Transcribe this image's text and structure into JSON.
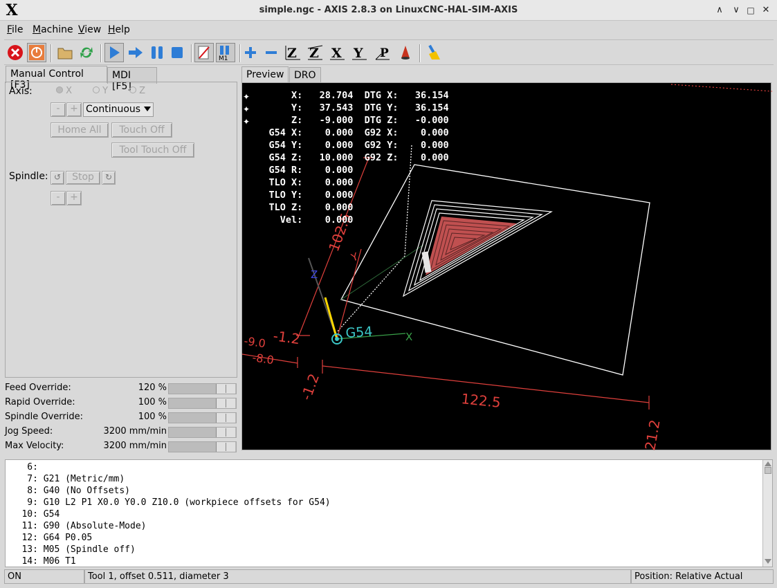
{
  "window": {
    "title": "simple.ngc - AXIS 2.8.3 on LinuxCNC-HAL-SIM-AXIS",
    "controls": {
      "collapse": "^",
      "minimize": "□",
      "close": "✕"
    }
  },
  "menu": [
    "File",
    "Machine",
    "View",
    "Help"
  ],
  "toolbar": {
    "icons": [
      "estop-icon",
      "machine-power-icon",
      "open-file-icon",
      "reload-icon",
      "run-icon",
      "step-icon",
      "pause-icon",
      "stop-icon",
      "block-delete-icon",
      "optional-stop-icon",
      "zoom-in-icon",
      "zoom-out-icon",
      "view-z-icon",
      "view-z2-icon",
      "view-x-icon",
      "view-y-icon",
      "view-p-icon",
      "rotate-view-icon",
      "clear-plot-icon"
    ],
    "optional_stop_label": "M1"
  },
  "left_tabs": [
    "Manual Control [F3]",
    "MDI [F5]"
  ],
  "manual": {
    "axis_label": "Axis:",
    "axes": [
      "X",
      "Y",
      "Z"
    ],
    "minus": "-",
    "plus": "+",
    "jog_mode": "Continuous",
    "home_all": "Home All",
    "touch_off": "Touch Off",
    "tool_touch_off": "Tool Touch Off",
    "spindle_label": "Spindle:",
    "spindle_stop": "Stop"
  },
  "overrides": [
    {
      "label": "Feed Override:",
      "value": "120 %",
      "level": 0.7
    },
    {
      "label": "Rapid Override:",
      "value": "100 %",
      "level": 0.7
    },
    {
      "label": "Spindle Override:",
      "value": "100 %",
      "level": 0.7
    },
    {
      "label": "Jog Speed:",
      "value": "3200 mm/min",
      "level": 0.7
    },
    {
      "label": "Max Velocity:",
      "value": "3200 mm/min",
      "level": 0.7
    }
  ],
  "preview_tabs": [
    "Preview",
    "DRO"
  ],
  "dro": [
    {
      "label": "X:",
      "value": "28.704",
      "label2": "DTG X:",
      "value2": "36.154"
    },
    {
      "label": "Y:",
      "value": "37.543",
      "label2": "DTG Y:",
      "value2": "36.154"
    },
    {
      "label": "Z:",
      "value": "-9.000",
      "label2": "DTG Z:",
      "value2": "-0.000"
    },
    {
      "label": "G54 X:",
      "value": "0.000",
      "label2": "G92 X:",
      "value2": "0.000"
    },
    {
      "label": "G54 Y:",
      "value": "0.000",
      "label2": "G92 Y:",
      "value2": "0.000"
    },
    {
      "label": "G54 Z:",
      "value": "10.000",
      "label2": "G92 Z:",
      "value2": "0.000"
    },
    {
      "label": "G54 R:",
      "value": "0.000",
      "label2": "",
      "value2": ""
    },
    {
      "label": "TLO X:",
      "value": "0.000",
      "label2": "",
      "value2": ""
    },
    {
      "label": "TLO Y:",
      "value": "0.000",
      "label2": "",
      "value2": ""
    },
    {
      "label": "TLO Z:",
      "value": "0.000",
      "label2": "",
      "value2": ""
    },
    {
      "label": "Vel:",
      "value": "0.000",
      "label2": "",
      "value2": ""
    }
  ],
  "preview_labels": {
    "dim_width": "122.5",
    "dim_left": "-1.2",
    "dim_height": "102.5",
    "dim_right": "21.2",
    "dim_z": "-1.2",
    "dim_z2": "-9.0",
    "dim_z3": "-8.0",
    "offset_label": "G54",
    "axis_x": "X",
    "axis_y": "Y",
    "axis_z": "Z"
  },
  "code_lines": [
    {
      "n": "6:",
      "text": ""
    },
    {
      "n": "7:",
      "text": "G21 (Metric/mm)"
    },
    {
      "n": "8:",
      "text": "G40 (No Offsets)"
    },
    {
      "n": "9:",
      "text": "G10 L2 P1 X0.0 Y0.0 Z10.0 (workpiece offsets for G54)"
    },
    {
      "n": "10:",
      "text": "G54"
    },
    {
      "n": "11:",
      "text": "G90 (Absolute-Mode)"
    },
    {
      "n": "12:",
      "text": "G64 P0.05"
    },
    {
      "n": "13:",
      "text": "M05 (Spindle off)"
    },
    {
      "n": "14:",
      "text": "M06 T1"
    }
  ],
  "status": {
    "state": "ON",
    "tool": "Tool 1, offset 0.511, diameter 3",
    "position": "Position: Relative Actual"
  },
  "colors": {
    "dim": "#e0403c",
    "offset": "#3cc8c8",
    "path": "#ffffff",
    "cut": "#c05050",
    "tool": "#ffd800"
  }
}
